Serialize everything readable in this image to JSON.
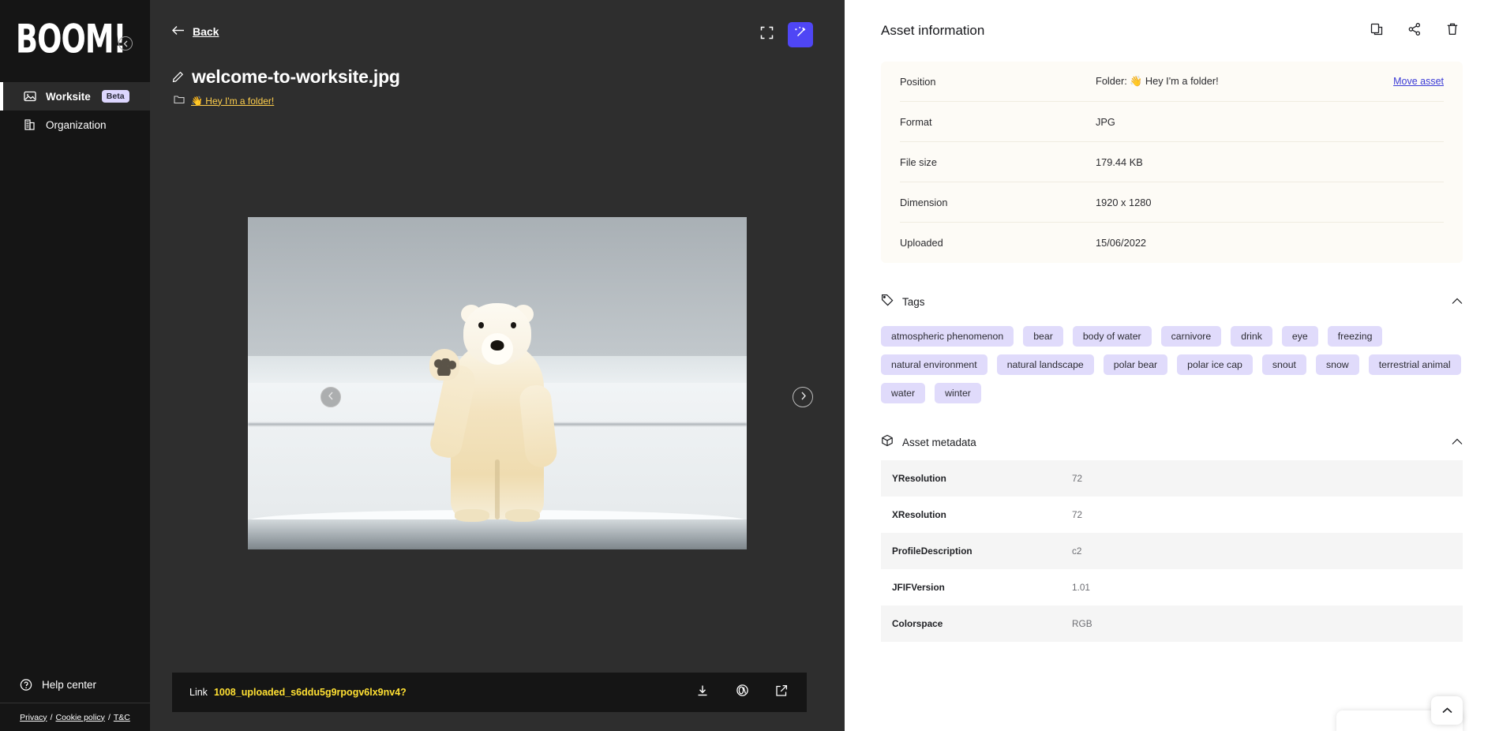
{
  "sidebar": {
    "logo": "BOOM!",
    "collapse_icon": "chevron-left-circle-icon",
    "items": [
      {
        "label": "Worksite",
        "icon": "image-icon",
        "badge": "Beta",
        "active": true
      },
      {
        "label": "Organization",
        "icon": "building-icon",
        "badge": "",
        "active": false
      }
    ],
    "help": {
      "label": "Help center",
      "icon": "question-circle-icon"
    },
    "legal": {
      "privacy": "Privacy",
      "sep1": "/",
      "cookie": "Cookie policy",
      "sep2": "/",
      "tc": "T&C"
    }
  },
  "viewer": {
    "back_label": "Back",
    "back_icon": "arrow-left-icon",
    "fullscreen_icon": "fullscreen-icon",
    "magic_icon": "magic-wand-icon",
    "accent_color": "#4f46f5",
    "asset_title": "welcome-to-worksite.jpg",
    "edit_icon": "pencil-icon",
    "folder_icon": "folder-icon",
    "breadcrumb_label": "👋 Hey I'm a folder!",
    "prev_icon": "chevron-left-icon",
    "next_icon": "chevron-right-icon",
    "image_alt": "polar bear standing on ice waving",
    "link": {
      "label": "Link",
      "value": "1008_uploaded_s6ddu5g9rpogv6lx9nv4?",
      "value_color": "#ffe033",
      "download_icon": "download-icon",
      "copy_link_icon": "link-icon",
      "open_external_icon": "external-link-icon"
    }
  },
  "panel": {
    "title": "Asset information",
    "actions": {
      "duplicate_icon": "copy-icon",
      "share_icon": "share-icon",
      "delete_icon": "trash-icon"
    },
    "info_rows": [
      {
        "key": "Position",
        "value": "Folder: 👋 Hey I'm a folder!",
        "action": "Move asset"
      },
      {
        "key": "Format",
        "value": "JPG",
        "action": ""
      },
      {
        "key": "File size",
        "value": "179.44 KB",
        "action": ""
      },
      {
        "key": "Dimension",
        "value": "1920 x 1280",
        "action": ""
      },
      {
        "key": "Uploaded",
        "value": "15/06/2022",
        "action": ""
      }
    ],
    "tags_section": {
      "title": "Tags",
      "icon": "tag-icon",
      "collapse_icon": "chevron-up-icon",
      "tags": [
        "atmospheric phenomenon",
        "bear",
        "body of water",
        "carnivore",
        "drink",
        "eye",
        "freezing",
        "natural environment",
        "natural landscape",
        "polar bear",
        "polar ice cap",
        "snout",
        "snow",
        "terrestrial animal",
        "water",
        "winter"
      ]
    },
    "metadata_section": {
      "title": "Asset metadata",
      "icon": "box-icon",
      "collapse_icon": "chevron-up-icon",
      "rows": [
        {
          "key": "YResolution",
          "value": "72"
        },
        {
          "key": "XResolution",
          "value": "72"
        },
        {
          "key": "ProfileDescription",
          "value": "c2"
        },
        {
          "key": "JFIFVersion",
          "value": "1.01"
        },
        {
          "key": "Colorspace",
          "value": "RGB"
        }
      ]
    },
    "scroll_top_icon": "chevron-up-icon"
  }
}
